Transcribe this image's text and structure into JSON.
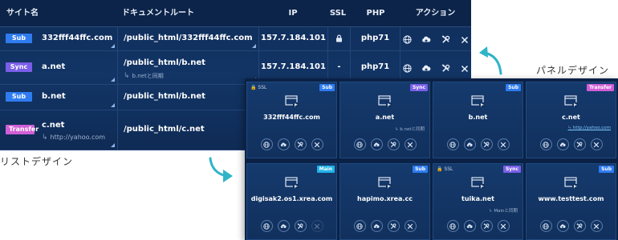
{
  "colors": {
    "sub": "#2f7cf0",
    "sync": "#7a5ee8",
    "transfer": "#d05fd6",
    "main": "#21b2e8",
    "teal_arrow": "#2fb4c8"
  },
  "list": {
    "headers": {
      "site": "サイト名",
      "docroot": "ドキュメントルート",
      "ip": "IP",
      "ssl": "SSL",
      "php": "PHP",
      "actions": "アクション"
    },
    "rows": [
      {
        "type": "Sub",
        "name": "332fff44ffc.com",
        "sub": "",
        "docroot": "/public_html/332fff44ffc.com",
        "docsub": "",
        "ip": "157.7.184.101",
        "ssl": "lock-icon",
        "php": "php71"
      },
      {
        "type": "Sync",
        "name": "a.net",
        "sub": "",
        "docroot": "/public_html/b.net",
        "docsub": "b.netと同期",
        "ip": "157.7.184.101",
        "ssl": "-",
        "php": "php71"
      },
      {
        "type": "Sub",
        "name": "b.net",
        "sub": "",
        "docroot": "/public_html/b.net",
        "docsub": "",
        "ip": "",
        "ssl": "",
        "php": ""
      },
      {
        "type": "Transfer",
        "name": "c.net",
        "sub": "http://yahoo.com",
        "docroot": "/public_html/c.net",
        "docsub": "",
        "ip": "",
        "ssl": "",
        "php": ""
      }
    ],
    "action_icons": [
      "globe-icon",
      "cloud-upload-icon",
      "tools-icon",
      "close-icon"
    ]
  },
  "captions": {
    "list_design": "リストデザイン",
    "panel_design": "パネルデザイン"
  },
  "panel": {
    "cards": [
      {
        "ssl": "SSL",
        "badge": "Sub",
        "name": "332fff44ffc.com",
        "sub": "",
        "link": false,
        "dim_last": false
      },
      {
        "ssl": "",
        "badge": "Sync",
        "name": "a.net",
        "sub": "b.netと同期",
        "link": false,
        "dim_last": false
      },
      {
        "ssl": "",
        "badge": "Sub",
        "name": "b.net",
        "sub": "",
        "link": false,
        "dim_last": false
      },
      {
        "ssl": "",
        "badge": "Transfer",
        "name": "c.net",
        "sub": "http://yahoo.com",
        "link": true,
        "dim_last": false
      },
      {
        "ssl": "",
        "badge": "Main",
        "name": "digisak2.os1.xrea.com",
        "sub": "",
        "link": false,
        "dim_last": true
      },
      {
        "ssl": "",
        "badge": "Sub",
        "name": "hapimo.xrea.cc",
        "sub": "",
        "link": false,
        "dim_last": false
      },
      {
        "ssl": "SSL",
        "badge": "Sync",
        "name": "tuika.net",
        "sub": "Mainと同期",
        "link": false,
        "dim_last": false
      },
      {
        "ssl": "",
        "badge": "Sub",
        "name": "www.testtest.com",
        "sub": "",
        "link": false,
        "dim_last": false
      }
    ]
  }
}
